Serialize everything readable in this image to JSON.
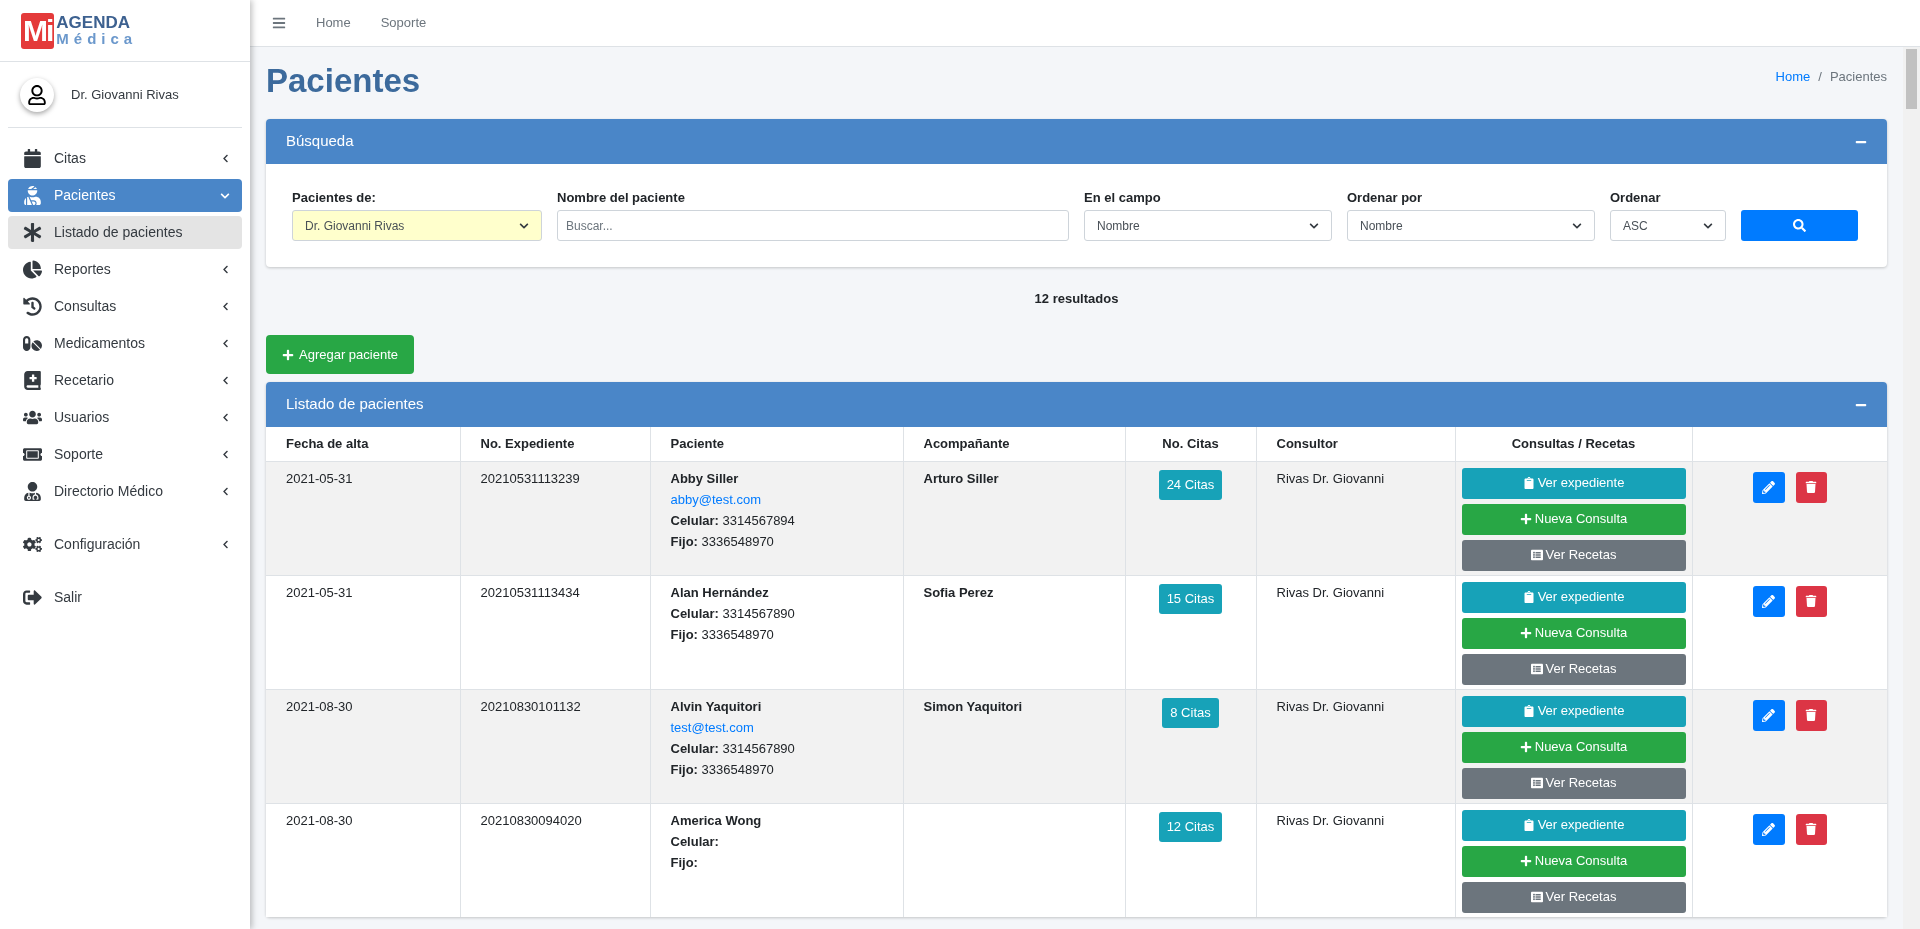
{
  "sidebar": {
    "logo": {
      "mark": "Mi",
      "line1": "AGENDA",
      "line2": "Médica"
    },
    "user": "Dr. Giovanni Rivas",
    "menu": [
      {
        "label": "Citas",
        "selected": false,
        "expanded": false
      },
      {
        "label": "Pacientes",
        "selected": true,
        "expanded": true,
        "children": [
          {
            "label": "Listado de pacientes",
            "selected": true
          }
        ]
      },
      {
        "label": "Reportes",
        "selected": false,
        "expanded": false
      },
      {
        "label": "Consultas",
        "selected": false,
        "expanded": false
      },
      {
        "label": "Medicamentos",
        "selected": false,
        "expanded": false
      },
      {
        "label": "Recetario",
        "selected": false,
        "expanded": false
      },
      {
        "label": "Usuarios",
        "selected": false,
        "expanded": false
      },
      {
        "label": "Soporte",
        "selected": false,
        "expanded": false
      },
      {
        "label": "Directorio Médico",
        "selected": false,
        "expanded": false
      },
      {
        "label": "Configuración",
        "selected": false,
        "expanded": false
      },
      {
        "label": "Salir"
      }
    ]
  },
  "navbar": {
    "links": [
      "Home",
      "Soporte"
    ]
  },
  "page": {
    "title": "Pacientes",
    "breadcrumb": [
      {
        "label": "Home",
        "link": true
      },
      {
        "label": "Pacientes",
        "link": false
      }
    ],
    "breadcrumb_separator": "/"
  },
  "search_card": {
    "title": "Búsqueda",
    "fields": [
      {
        "label": "Pacientes de:",
        "kind": "select",
        "value": "Dr. Giovanni Rivas",
        "highlighted": true
      },
      {
        "label": "Nombre del paciente",
        "kind": "text",
        "placeholder": "Buscar..."
      },
      {
        "label": "En el campo",
        "kind": "select",
        "value": "Nombre",
        "highlighted": false
      },
      {
        "label": "Ordenar por",
        "kind": "select",
        "value": "Nombre",
        "highlighted": false
      },
      {
        "label": "Ordenar",
        "kind": "select",
        "value": "ASC",
        "highlighted": false
      }
    ]
  },
  "results": "12 resultados",
  "add_button": "Agregar paciente",
  "table_card": {
    "title": "Listado de pacientes",
    "columns": [
      "Fecha de alta",
      "No. Expediente",
      "Paciente",
      "Acompañante",
      "No. Citas",
      "Consultor",
      "Consultas / Recetas"
    ],
    "rows": [
      {
        "fecha": "2021-05-31",
        "expediente": "20210531113239",
        "name": "Abby Siller",
        "email": "abby@test.com",
        "celular": "**Celular:** 3314567894",
        "fijo": "**Fijo:** 3336548970",
        "acompanante": "Arturo Siller",
        "citas": "24 Citas",
        "consultor": "Rivas Dr. Giovanni",
        "buttons": [
          "Ver expediente",
          "Nueva Consulta",
          "Ver Recetas"
        ]
      },
      {
        "fecha": "2021-05-31",
        "expediente": "20210531113434",
        "name": "Alan Hernández",
        "celular": "**Celular:** 3314567890",
        "fijo": "**Fijo:** 3336548970",
        "acompanante": "Sofia Perez",
        "citas": "15 Citas",
        "consultor": "Rivas Dr. Giovanni",
        "buttons": [
          "Ver expediente",
          "Nueva Consulta",
          "Ver Recetas"
        ]
      },
      {
        "fecha": "2021-08-30",
        "expediente": "20210830101132",
        "name": "Alvin Yaquitori",
        "email": "test@test.com",
        "celular": "**Celular:** 3314567890",
        "fijo": "**Fijo:** 3336548970",
        "acompanante": "Simon Yaquitori",
        "citas": "8 Citas",
        "consultor": "Rivas Dr. Giovanni",
        "buttons": [
          "Ver expediente",
          "Nueva Consulta",
          "Ver Recetas"
        ]
      },
      {
        "fecha": "2021-08-30",
        "expediente": "20210830094020",
        "name": "America Wong",
        "celular": "**Celular:**",
        "fijo": "**Fijo:**",
        "citas": "12 Citas",
        "consultor": "Rivas Dr. Giovanni",
        "buttons": [
          "Ver expediente",
          "Nueva Consulta",
          "Ver Recetas"
        ]
      }
    ]
  }
}
